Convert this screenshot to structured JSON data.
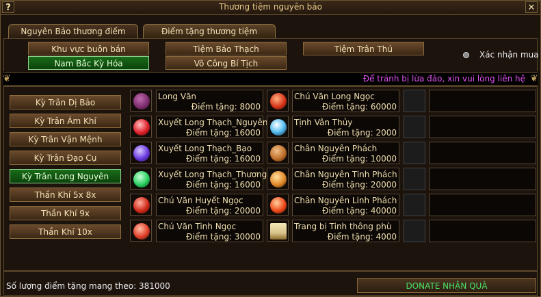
{
  "window": {
    "title": "Thương tiệm nguyên bảo",
    "help_label": "?",
    "close_label": "✕"
  },
  "tabs": [
    {
      "label": "Nguyên Bảo thương điếm",
      "active": false
    },
    {
      "label": "Điểm tặng thương tiệm",
      "active": true
    }
  ],
  "categories": [
    {
      "label": "Khu vực buôn bán",
      "selected": false
    },
    {
      "label": "Tiệm Bảo Thạch",
      "selected": false
    },
    {
      "label": "Tiệm Trân Thú",
      "selected": false
    },
    {
      "label": "Nam Bắc Kỳ Hóa",
      "selected": true
    },
    {
      "label": "Võ Công Bí Tịch",
      "selected": false
    }
  ],
  "confirm_purchase_label": "Xác nhận mua",
  "notice": "Để tránh bị lừa đảo, xin vui lòng liên hệ",
  "sidebar": [
    {
      "label": "Kỳ Trân Dị Bảo",
      "selected": false
    },
    {
      "label": "Kỳ Trân Ám Khí",
      "selected": false
    },
    {
      "label": "Kỳ Trân Vận Mệnh",
      "selected": false
    },
    {
      "label": "Kỳ Trân Đạo Cụ",
      "selected": false
    },
    {
      "label": "Kỳ Trân Long Nguyên",
      "selected": true
    },
    {
      "label": "Thần Khí 5x 8x",
      "selected": false
    },
    {
      "label": "Thần Khí 9x",
      "selected": false
    },
    {
      "label": "Thần Khí 10x",
      "selected": false
    }
  ],
  "items": [
    {
      "name": "Long Văn",
      "price": "Điểm tặng: 8000",
      "icon": "dragon-emblem-icon",
      "color": "#7a2a6a"
    },
    {
      "name": "Chú Văn Long Ngọc",
      "price": "Điểm tặng: 60000",
      "icon": "red-dragon-jade-icon",
      "color": "#d8351a"
    },
    {
      "name": "Xuyết Long Thạch_Nguyên",
      "price": "Điểm tặng: 16000",
      "icon": "red-gem-icon",
      "color": "#e0202a"
    },
    {
      "name": "Tịnh Vân Thủy",
      "price": "Điểm tặng: 2000",
      "icon": "blue-water-icon",
      "color": "#5ac0f0"
    },
    {
      "name": "Xuyết Long Thạch_Bạo",
      "price": "Điểm tặng: 16000",
      "icon": "purple-gem-icon",
      "color": "#6a3ae0"
    },
    {
      "name": "Chân Nguyên Phách",
      "price": "Điểm tặng: 10000",
      "icon": "bronze-shard-icon",
      "color": "#c0702a"
    },
    {
      "name": "Xuyết Long Thạch_Thương",
      "price": "Điểm tặng: 16000",
      "icon": "green-gem-icon",
      "color": "#2ad060"
    },
    {
      "name": "Chân Nguyên Tinh Phách",
      "price": "Điểm tặng: 20000",
      "icon": "orange-shard-icon",
      "color": "#e08a2a"
    },
    {
      "name": "Chú Văn Huyết Ngọc",
      "price": "Điểm tặng: 20000",
      "icon": "blood-jade-icon",
      "color": "#d02a1a"
    },
    {
      "name": "Chân Nguyên Linh Phách",
      "price": "Điểm tặng: 40000",
      "icon": "fire-shard-icon",
      "color": "#f04a1a"
    },
    {
      "name": "Chú Văn Tinh Ngọc",
      "price": "Điểm tặng: 30000",
      "icon": "star-jade-icon",
      "color": "#e0402a"
    },
    {
      "name": "Trang bị Tinh thông phù",
      "price": "Điểm tặng: 4000",
      "icon": "scroll-icon",
      "color": "#d8c48a"
    }
  ],
  "footer": {
    "points_text": "Số lượng điểm tặng mang theo: 381000",
    "donate_label": "DONATE NHẬN QUÀ"
  }
}
